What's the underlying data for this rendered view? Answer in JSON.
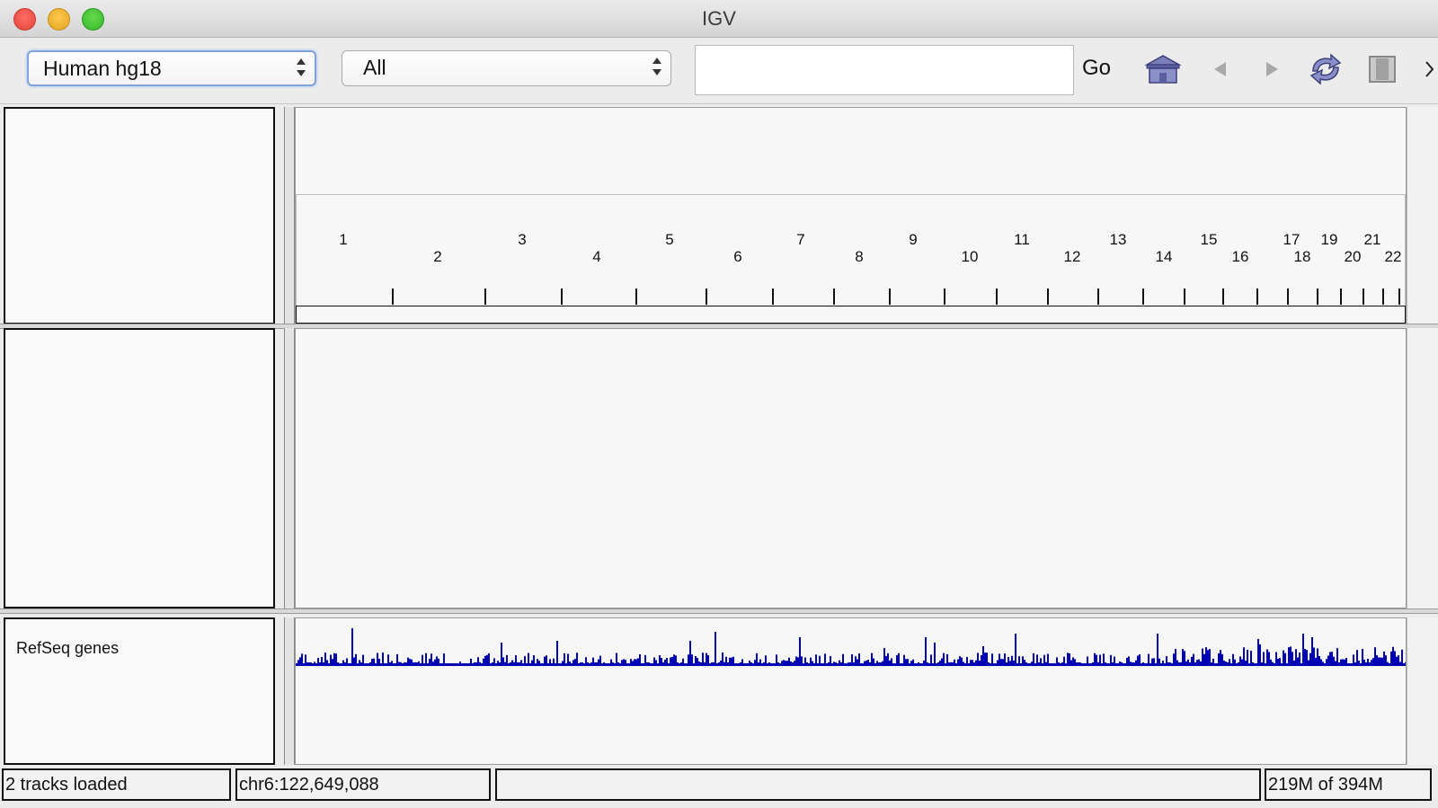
{
  "window": {
    "title": "IGV"
  },
  "toolbar": {
    "genome_select": "Human hg18",
    "chromosome_select": "All",
    "locus_input": "",
    "go_label": "Go",
    "icons": [
      "home-icon",
      "back-icon",
      "forward-icon",
      "refresh-icon",
      "roi-icon",
      "resize-icon"
    ]
  },
  "ruler": {
    "chromosomes_top": [
      "1",
      "3",
      "5",
      "7",
      "9",
      "11",
      "13",
      "15",
      "17",
      "19",
      "21"
    ],
    "chromosomes_bottom": [
      "2",
      "4",
      "6",
      "8",
      "10",
      "12",
      "14",
      "16",
      "18",
      "20",
      "22"
    ]
  },
  "tracks": [
    {
      "name": "RefSeq genes",
      "color": "#0000b4"
    }
  ],
  "status": {
    "tracks_loaded": "2 tracks loaded",
    "position": "chr6:122,649,088",
    "message": "",
    "memory": "219M of 394M"
  }
}
